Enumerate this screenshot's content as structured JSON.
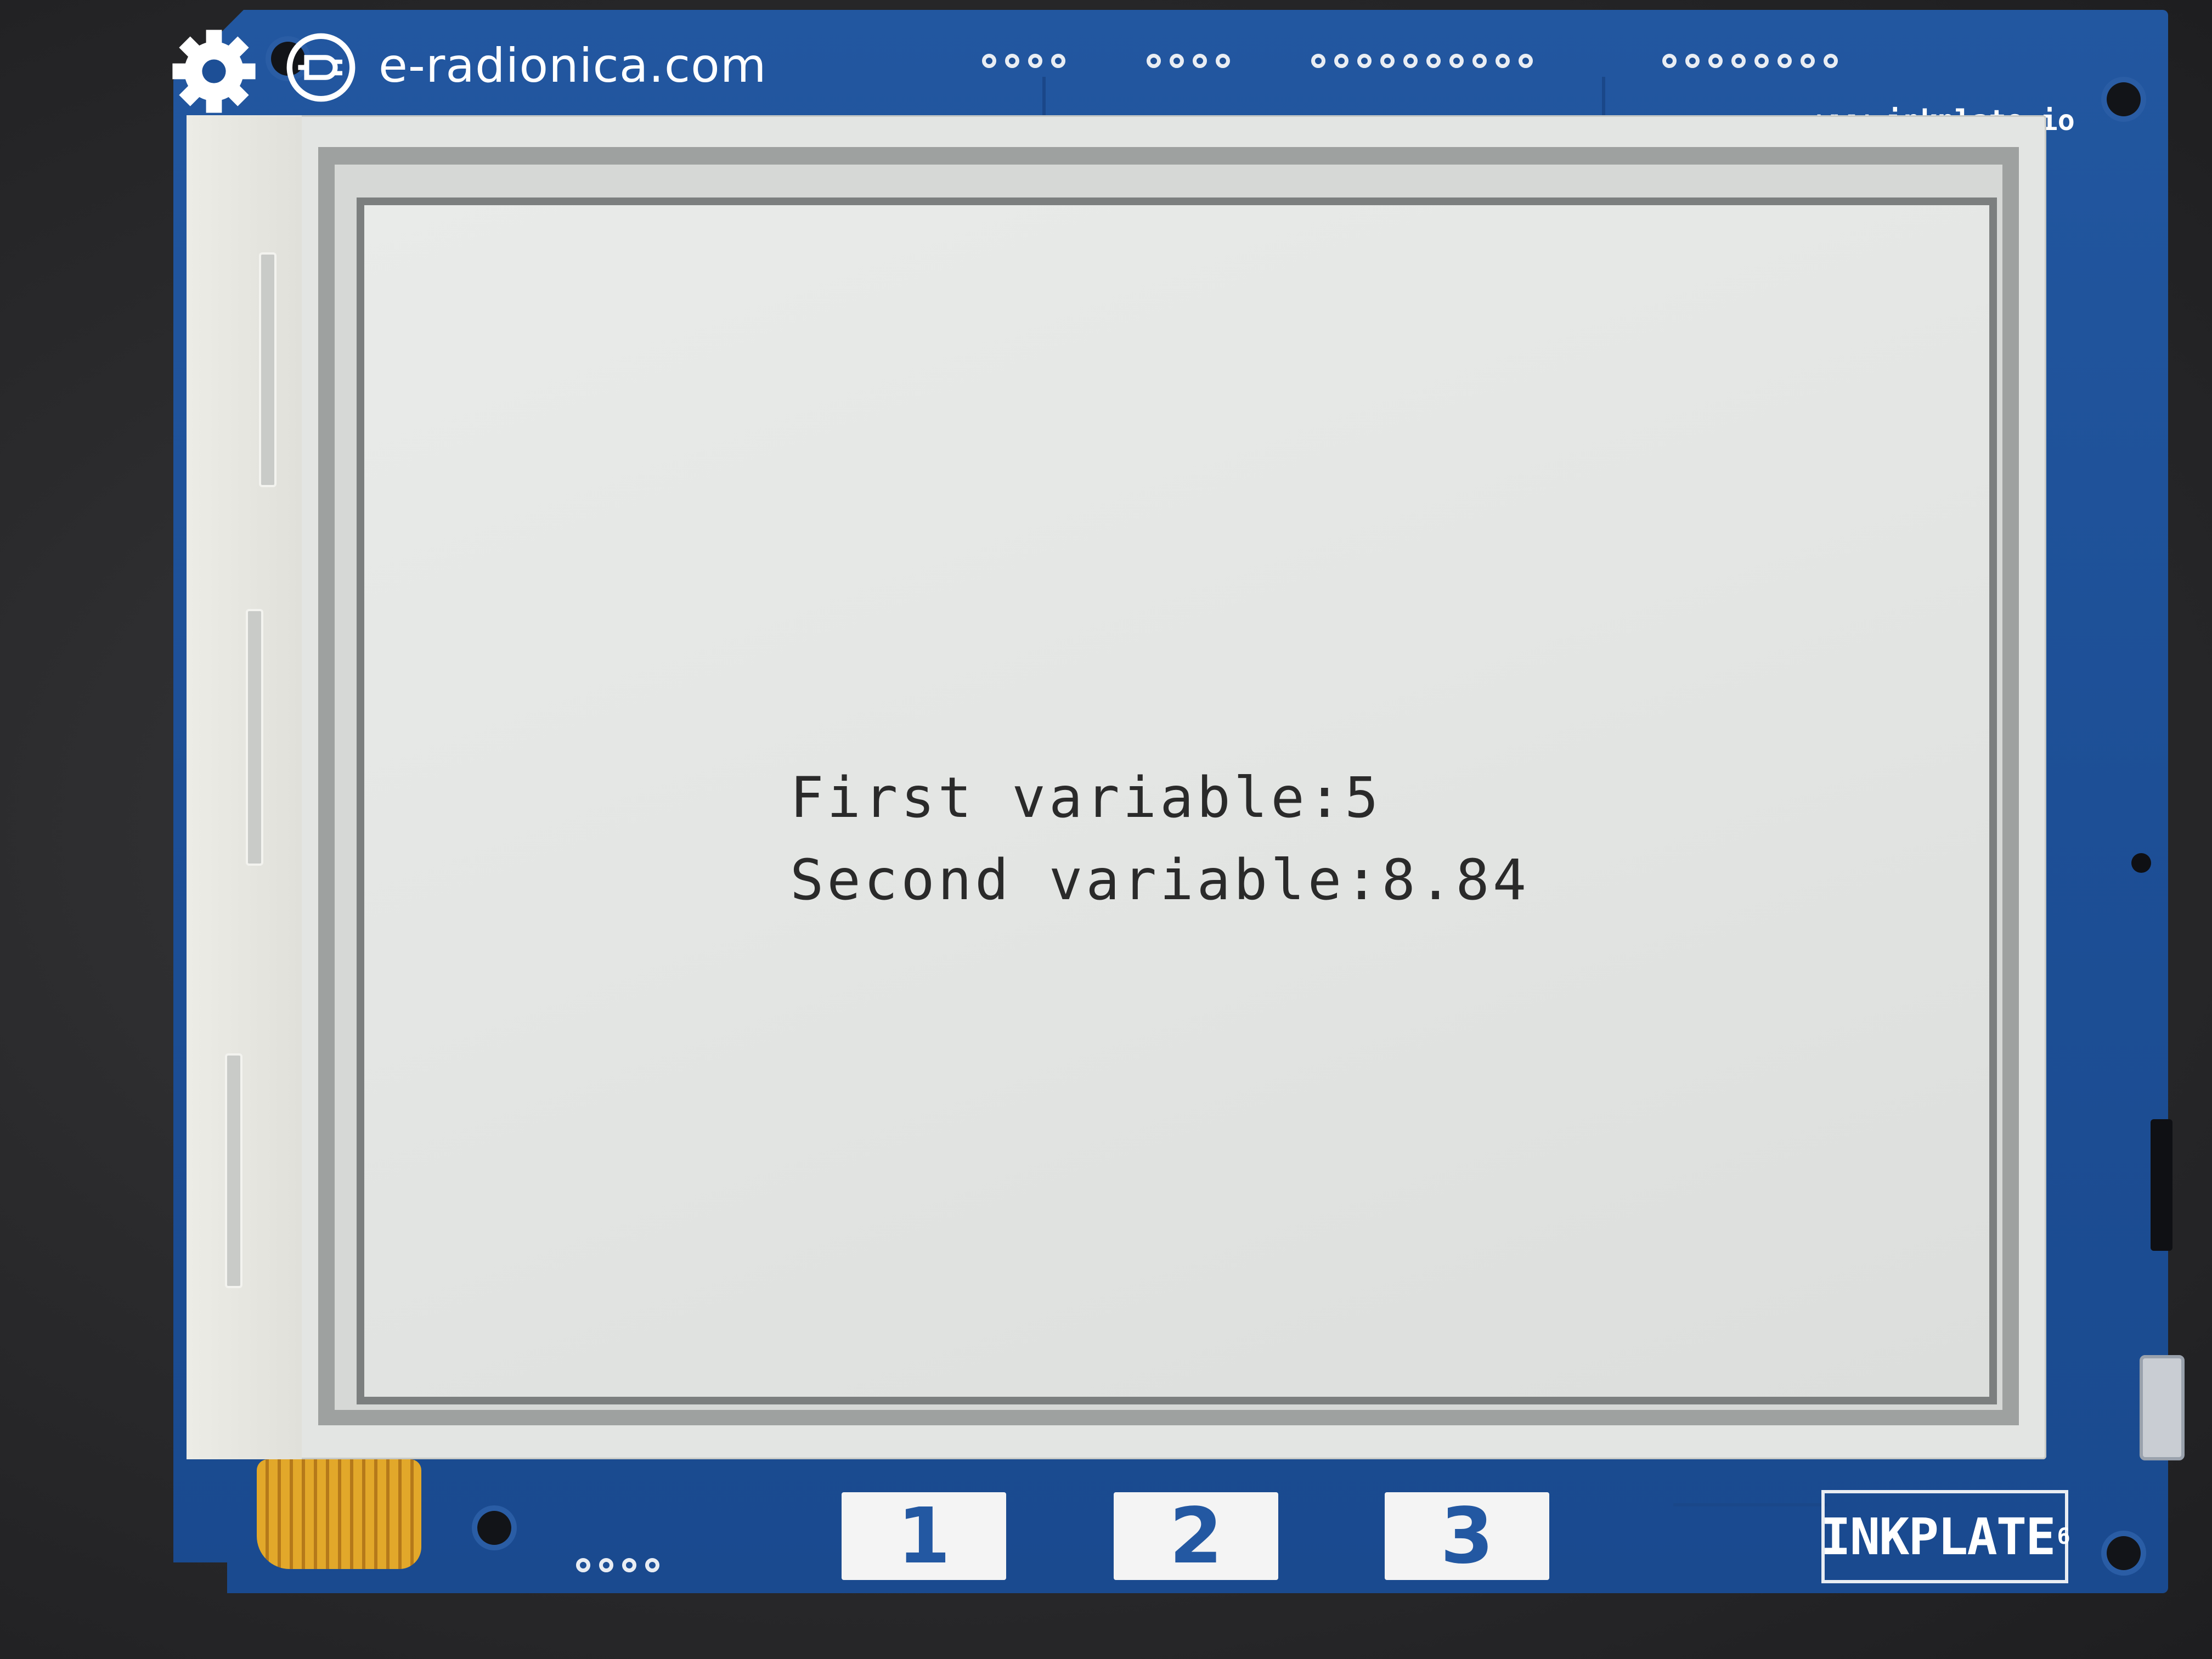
{
  "board": {
    "brand_text": "e-radionica.com",
    "url_text": "www.inkplate.io",
    "model_text": "INKPLATE",
    "model_suffix": "6",
    "buttons": [
      "1",
      "2",
      "3"
    ]
  },
  "display": {
    "line1": "First variable:5",
    "line2": "Second variable:8.84"
  },
  "colors": {
    "pcb_blue": "#1d4f96",
    "eink_background": "#e4e6e4",
    "eink_text": "#2a2a2a"
  },
  "icons": [
    "gear-icon",
    "plug-logo-icon"
  ]
}
